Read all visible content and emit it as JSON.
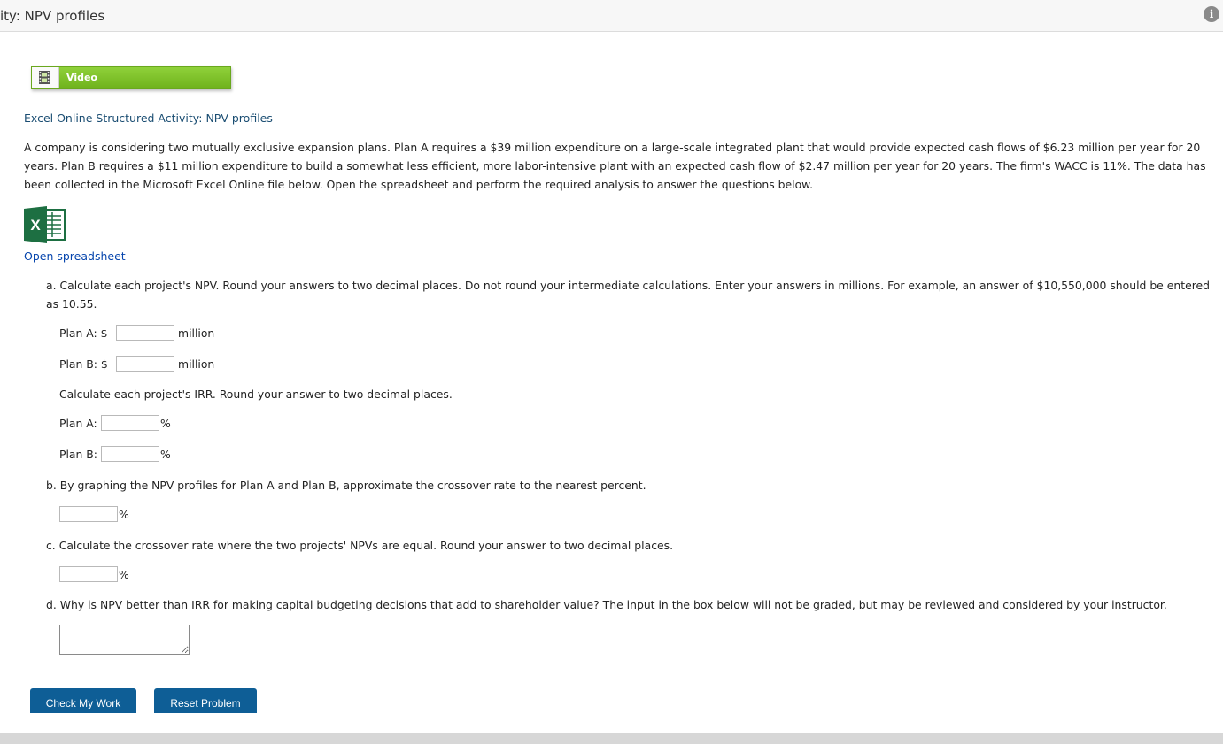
{
  "window": {
    "title": "ity: NPV profiles"
  },
  "video": {
    "label": "Video"
  },
  "activity_title": "Excel Online Structured Activity: NPV profiles",
  "problem_text": "A company is considering two mutually exclusive expansion plans. Plan A requires a $39 million expenditure on a large-scale integrated plant that would provide expected cash flows of $6.23 million per year for 20 years. Plan B requires a $11 million expenditure to build a somewhat less efficient, more labor-intensive plant with an expected cash flow of $2.47 million per year for 20 years. The firm's WACC is 11%. The data has been collected in the Microsoft Excel Online file below. Open the spreadsheet and perform the required analysis to answer the questions below.",
  "spreadsheet": {
    "icon": "excel-icon",
    "link_label": "Open spreadsheet"
  },
  "questions": {
    "a": {
      "text": "a. Calculate each project's NPV. Round your answers to two decimal places. Do not round your intermediate calculations. Enter your answers in millions. For example, an answer of $10,550,000 should be entered as 10.55.",
      "npv_plan_a_label": "Plan A: $",
      "npv_plan_b_label": "Plan B: $",
      "npv_unit": "million",
      "npv_plan_a_value": "",
      "npv_plan_b_value": "",
      "irr_text": "Calculate each project's IRR. Round your answer to two decimal places.",
      "irr_plan_a_label": "Plan A:",
      "irr_plan_b_label": "Plan B:",
      "irr_unit": "%",
      "irr_plan_a_value": "",
      "irr_plan_b_value": ""
    },
    "b": {
      "text": "b. By graphing the NPV profiles for Plan A and Plan B, approximate the crossover rate to the nearest percent.",
      "unit": "%",
      "value": ""
    },
    "c": {
      "text": "c. Calculate the crossover rate where the two projects' NPVs are equal. Round your answer to two decimal places.",
      "unit": "%",
      "value": ""
    },
    "d": {
      "text": "d. Why is NPV better than IRR for making capital budgeting decisions that add to shareholder value? The input in the box below will not be graded, but may be reviewed and considered by your instructor.",
      "value": ""
    }
  },
  "buttons": {
    "check": "Check My Work",
    "reset": "Reset Problem"
  },
  "colors": {
    "video_green": "#7cc42a",
    "button_blue": "#0e5e96",
    "excel_green": "#1d6f42",
    "link_blue": "#0645ad"
  }
}
